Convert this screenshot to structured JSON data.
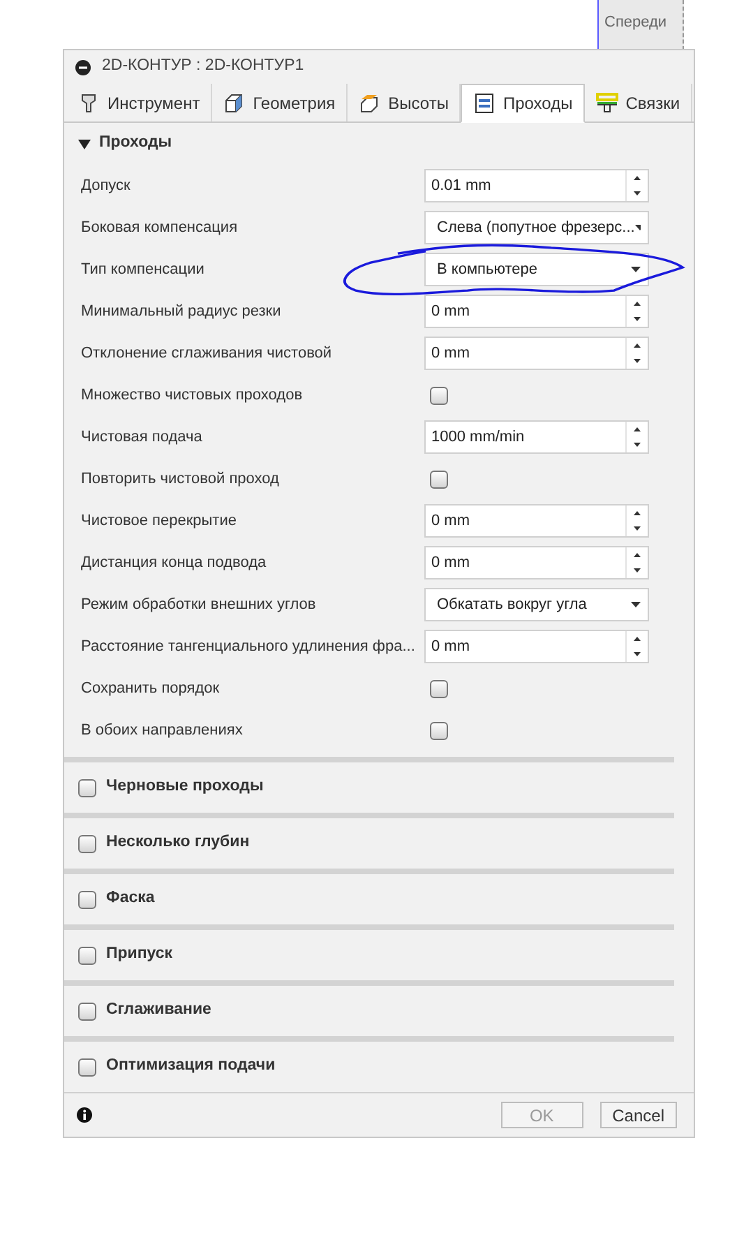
{
  "viewcube": {
    "label": "Спереди"
  },
  "window": {
    "title": "2D-КОНТУР : 2D-КОНТУР1"
  },
  "tabs": [
    {
      "label": "Инструмент",
      "kind": "tool",
      "selected": false
    },
    {
      "label": "Геометрия",
      "kind": "geometry",
      "selected": false
    },
    {
      "label": "Высоты",
      "kind": "heights",
      "selected": false
    },
    {
      "label": "Проходы",
      "kind": "passes",
      "selected": true
    },
    {
      "label": "Связки",
      "kind": "linking",
      "selected": false
    }
  ],
  "section": {
    "title": "Проходы",
    "expanded": true
  },
  "fields": [
    {
      "label": "Допуск",
      "kind": "spin",
      "value": "0.01 mm"
    },
    {
      "label": "Боковая компенсация",
      "kind": "select",
      "value": "Слева (попутное фрезерс..."
    },
    {
      "label": "Тип компенсации",
      "kind": "select",
      "value": "В компьютере"
    },
    {
      "label": "Минимальный радиус резки",
      "kind": "spin",
      "value": "0 mm"
    },
    {
      "label": "Отклонение сглаживания чистовой",
      "kind": "spin",
      "value": "0 mm"
    },
    {
      "label": "Множество чистовых проходов",
      "kind": "check",
      "checked": false
    },
    {
      "label": "Чистовая подача",
      "kind": "spin",
      "value": "1000 mm/min"
    },
    {
      "label": "Повторить чистовой проход",
      "kind": "check",
      "checked": false
    },
    {
      "label": "Чистовое перекрытие",
      "kind": "spin",
      "value": "0 mm"
    },
    {
      "label": "Дистанция конца подвода",
      "kind": "spin",
      "value": "0 mm"
    },
    {
      "label": "Режим обработки внешних углов",
      "kind": "select",
      "value": "Обкатать вокруг угла"
    },
    {
      "label": "Расстояние тангенциального удлинения фра...",
      "kind": "spin",
      "value": "0 mm"
    },
    {
      "label": "Сохранить порядок",
      "kind": "check",
      "checked": false
    },
    {
      "label": "В обоих направлениях",
      "kind": "check",
      "checked": false
    }
  ],
  "groups": [
    {
      "title": "Черновые проходы",
      "checked": false
    },
    {
      "title": "Несколько глубин",
      "checked": false
    },
    {
      "title": "Фаска",
      "checked": false
    },
    {
      "title": "Припуск",
      "checked": false
    },
    {
      "title": "Сглаживание",
      "checked": false
    },
    {
      "title": "Оптимизация подачи",
      "checked": false
    }
  ],
  "buttons": [
    {
      "label": "OK",
      "disabled": true
    },
    {
      "label": "Cancel",
      "disabled": false
    }
  ]
}
